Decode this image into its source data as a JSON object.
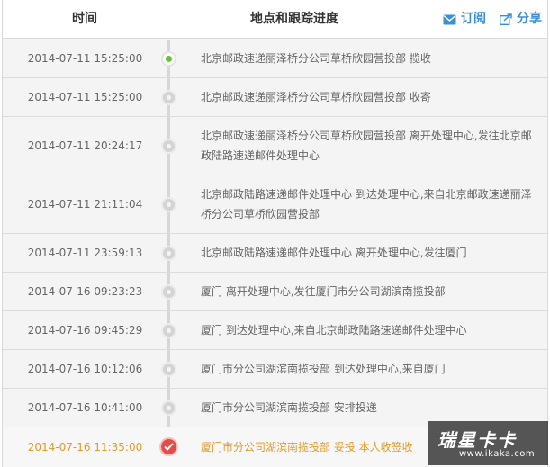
{
  "header": {
    "time_label": "时间",
    "progress_label": "地点和跟踪进度",
    "subscribe_label": "订阅",
    "share_label": "分享"
  },
  "events": [
    {
      "time": "2014-07-11 15:25:00",
      "desc": "北京邮政速递丽泽桥分公司草桥欣园营投部 揽收",
      "status": "current"
    },
    {
      "time": "2014-07-11 15:25:00",
      "desc": "北京邮政速递丽泽桥分公司草桥欣园营投部 收寄",
      "status": "normal"
    },
    {
      "time": "2014-07-11 20:24:17",
      "desc": "北京邮政速递丽泽桥分公司草桥欣园营投部 离开处理中心,发往北京邮政陆路速递邮件处理中心",
      "status": "normal"
    },
    {
      "time": "2014-07-11 21:11:04",
      "desc": "北京邮政陆路速递邮件处理中心 到达处理中心,来自北京邮政速递丽泽桥分公司草桥欣园营投部",
      "status": "normal"
    },
    {
      "time": "2014-07-11 23:59:13",
      "desc": "北京邮政陆路速递邮件处理中心 离开处理中心,发往厦门",
      "status": "normal"
    },
    {
      "time": "2014-07-16 09:23:23",
      "desc": "厦门 离开处理中心,发往厦门市分公司湖滨南揽投部",
      "status": "normal"
    },
    {
      "time": "2014-07-16 09:45:29",
      "desc": "厦门 到达处理中心,来自北京邮政陆路速递邮件处理中心",
      "status": "normal"
    },
    {
      "time": "2014-07-16 10:12:06",
      "desc": "厦门市分公司湖滨南揽投部 到达处理中心,来自厦门",
      "status": "normal"
    },
    {
      "time": "2014-07-16 10:41:00",
      "desc": "厦门市分公司湖滨南揽投部 安排投递",
      "status": "normal"
    },
    {
      "time": "2014-07-16 11:35:00",
      "desc": "厦门市分公司湖滨南揽投部 妥投 本人收签收",
      "status": "signed"
    }
  ],
  "watermark": {
    "main": "瑞星卡卡",
    "sub": "www.ikaka.com"
  },
  "colors": {
    "accent": "#3b8fd6",
    "current_dot": "#5ec72f",
    "signed_dot": "#e44b4b",
    "final_text": "#e39a2b"
  }
}
